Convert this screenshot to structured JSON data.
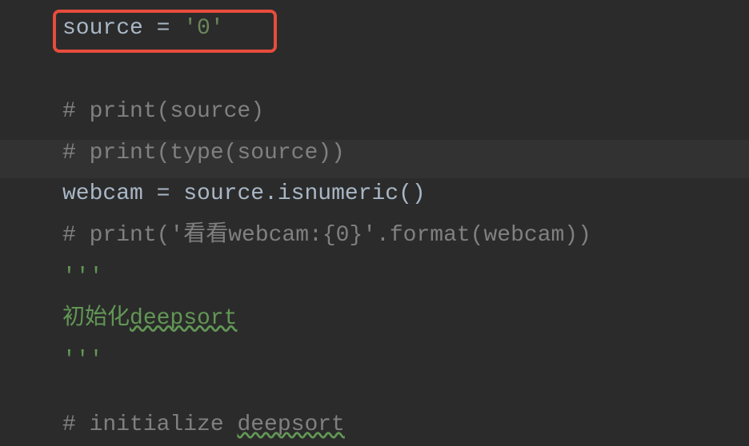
{
  "code": {
    "line1": {
      "var": "source ",
      "op": "= ",
      "str": "'0'"
    },
    "line2": "# print(source)",
    "line3": "# print(type(source))",
    "line4": {
      "var1": "webcam ",
      "op": "= ",
      "var2": "source",
      "dot": ".",
      "method": "isnumeric()"
    },
    "line5": "# print('看看webcam:{0}'.format(webcam))",
    "line6": "'''",
    "line7_part1": "初始化",
    "line7_part2": "deepsort",
    "line8": "'''",
    "line9_part1": "# initialize ",
    "line9_part2": "deepsort"
  }
}
